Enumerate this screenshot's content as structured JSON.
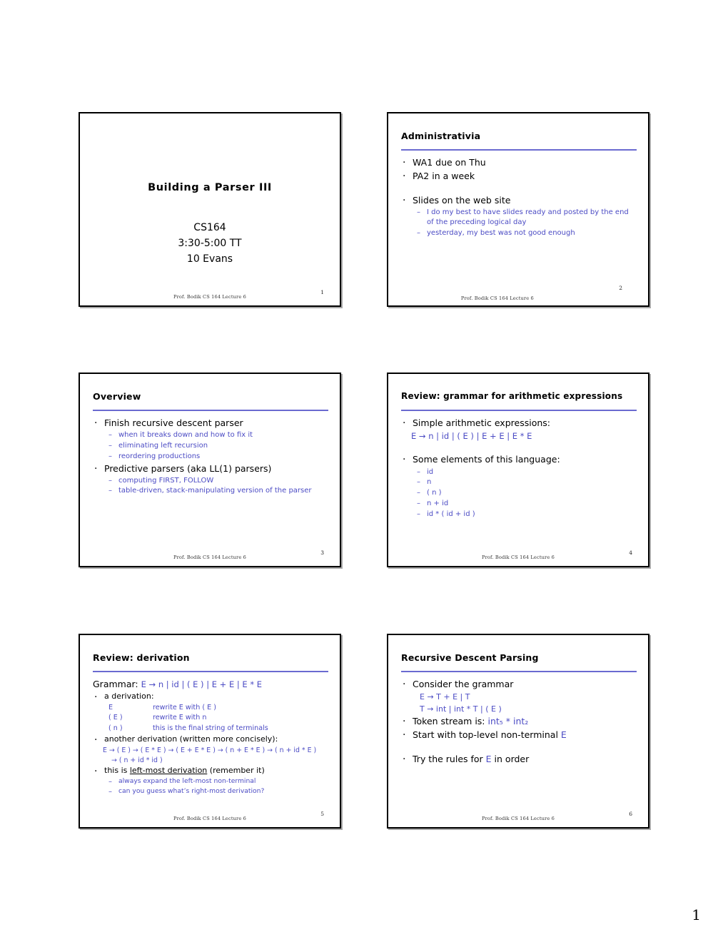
{
  "document": {
    "page_number": "1",
    "footer_text": "Prof. Bodik  CS 164  Lecture 6"
  },
  "colors": {
    "accent_blue": "#4b4bc4",
    "rule_blue": "#6a6ad0",
    "text_black": "#000000"
  },
  "slides": [
    {
      "number": "1",
      "kind": "title",
      "title": "Building a Parser III",
      "sub_lines": [
        "CS164",
        "3:30-5:00 TT",
        "10 Evans"
      ]
    },
    {
      "number": "2",
      "kind": "content",
      "title": "Administrativia",
      "bullets": [
        "WA1 due on Thu",
        "PA2 in a week",
        "Slides on the web site"
      ],
      "sub_bullets": [
        "I do my best to have slides ready and posted by the end of the preceding logical day",
        "yesterday, my best was not good enough"
      ]
    },
    {
      "number": "3",
      "kind": "content",
      "title": "Overview",
      "bullet_1": "Finish recursive descent parser",
      "sub_1": [
        "when it breaks down and how to fix it",
        "eliminating left recursion",
        "reordering productions"
      ],
      "bullet_2": "Predictive parsers (aka LL(1) parsers)",
      "sub_2": [
        "computing FIRST, FOLLOW",
        "table-driven, stack-manipulating version of the parser"
      ]
    },
    {
      "number": "4",
      "kind": "content",
      "title": "Review: grammar for arithmetic expressions",
      "bullet_1": "Simple arithmetic expressions:",
      "grammar": "E → n  |  id  |  ( E )  |  E + E  |  E * E",
      "bullet_2": "Some elements of this language:",
      "elements": [
        "id",
        "n",
        "( n )",
        "n + id",
        "id * ( id + id )"
      ]
    },
    {
      "number": "5",
      "kind": "content",
      "title": "Review:  derivation",
      "grammar_label": "Grammar:",
      "grammar": "E → n  |  id  |  ( E )  |  E + E  |  E * E",
      "bullet_1": "a derivation:",
      "derivation_rows": [
        {
          "lhs": "E",
          "rhs": "rewrite E with ( E )"
        },
        {
          "lhs": "( E )",
          "rhs": "rewrite E with n"
        },
        {
          "lhs": "( n )",
          "rhs": "this is the final string of terminals"
        }
      ],
      "bullet_2": "another derivation (written more concisely):",
      "concise_line_1": "E → ( E ) → ( E * E ) → ( E + E * E ) → ( n + E * E ) → ( n + id * E )",
      "concise_line_2": "→ ( n + id * id )",
      "bullet_3_pre": "this is ",
      "bullet_3_underlined": "left-most derivation",
      "bullet_3_post": " (remember it)",
      "sub_3": [
        "always expand the left-most non-terminal",
        "can you guess what’s right-most derivation?"
      ]
    },
    {
      "number": "6",
      "kind": "content",
      "title": "Recursive Descent Parsing",
      "bullet_1": "Consider the grammar",
      "rules": [
        "E → T + E | T",
        "T → int  | int * T | ( E )"
      ],
      "bullet_2_pre": "Token stream is:   ",
      "bullet_2_tokens": "int₅ * int₂",
      "bullet_3_pre": "Start with top-level non-terminal ",
      "bullet_3_sym": "E",
      "bullet_4_pre": "Try the rules for ",
      "bullet_4_sym": "E",
      "bullet_4_post": " in order"
    }
  ]
}
